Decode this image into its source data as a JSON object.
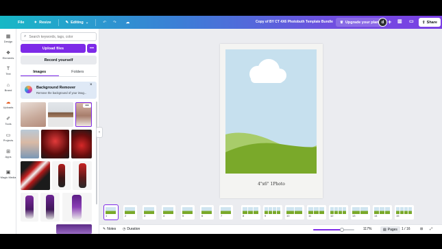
{
  "topbar": {
    "file_label": "File",
    "resize_label": "Resize",
    "editing_label": "Editing",
    "doc_title": "Copy of BY CT 4X6 Photobuth Template Bundle",
    "upgrade_label": "Upgrade your plan",
    "avatar_initial": "d",
    "share_label": "Share"
  },
  "rail": {
    "items": [
      {
        "label": "Design",
        "icon": "design-icon"
      },
      {
        "label": "Elements",
        "icon": "elements-icon"
      },
      {
        "label": "Text",
        "icon": "text-icon"
      },
      {
        "label": "Brand",
        "icon": "brand-icon"
      },
      {
        "label": "Uploads",
        "icon": "uploads-icon"
      },
      {
        "label": "Tools",
        "icon": "tools-icon"
      },
      {
        "label": "Projects",
        "icon": "projects-icon"
      },
      {
        "label": "Apps",
        "icon": "apps-icon"
      },
      {
        "label": "Magic Media",
        "icon": "magic-media-icon"
      }
    ]
  },
  "panel": {
    "search_placeholder": "Search keywords, tags, color",
    "upload_label": "Upload files",
    "record_label": "Record yourself",
    "tabs": [
      "Images",
      "Folders"
    ],
    "bg_remover_title": "Background Remover",
    "bg_remover_desc": "Remove the background of your imag..."
  },
  "canvas": {
    "caption": "4\"x6\" 1Photo"
  },
  "filmstrip": {
    "pages": [
      "1",
      "2",
      "3",
      "4",
      "5",
      "6",
      "7",
      "8",
      "9",
      "10",
      "11",
      "12",
      "13",
      "14",
      "15"
    ]
  },
  "bottombar": {
    "notes_label": "Notes",
    "duration_label": "Duration",
    "zoom": "117%",
    "zoom_fraction": 0.7,
    "pages_label": "Pages",
    "page_counter": "1 / 16"
  },
  "colors": {
    "accent": "#7d2ae8",
    "sky": "#c6e0ee",
    "grass": "#7aa92a"
  }
}
